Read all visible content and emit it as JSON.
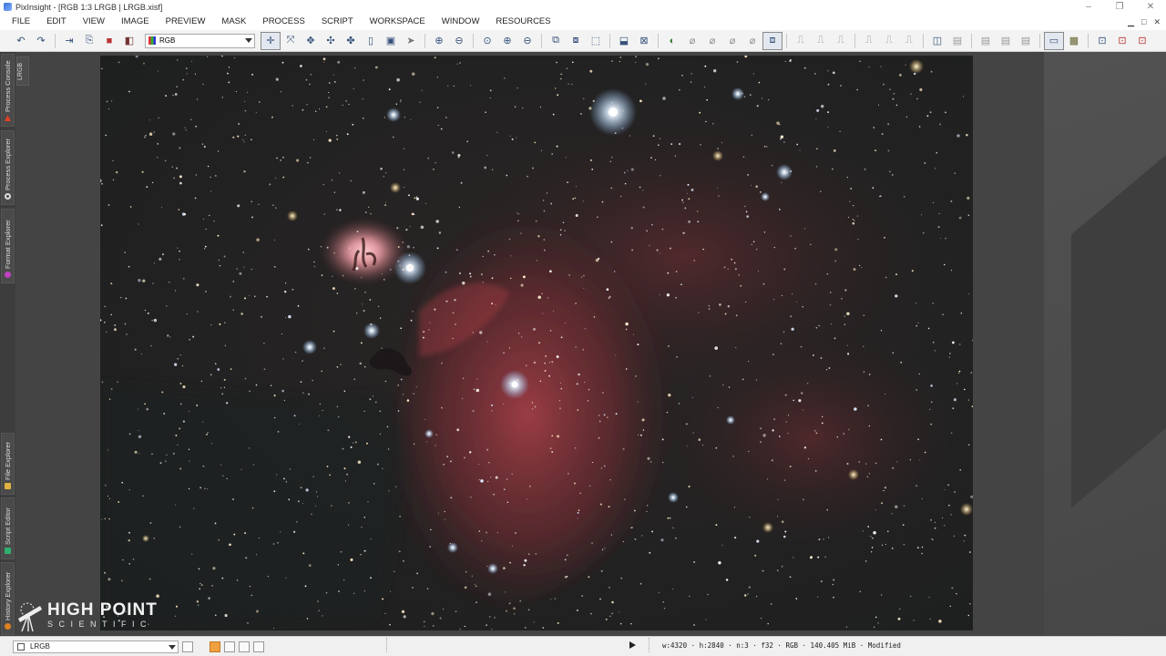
{
  "window": {
    "title": "PixInsight - [RGB 1:3 LRGB | LRGB.xisf]",
    "controls": [
      "–",
      "❐",
      "✕"
    ]
  },
  "menubar": {
    "items": [
      "FILE",
      "EDIT",
      "VIEW",
      "IMAGE",
      "PREVIEW",
      "MASK",
      "PROCESS",
      "SCRIPT",
      "WORKSPACE",
      "WINDOW",
      "RESOURCES"
    ]
  },
  "toolbar": {
    "channel_select": "RGB"
  },
  "sidebar": {
    "tabs": [
      "Process Console",
      "Process Explorer",
      "Format Explorer",
      "File Explorer",
      "Script Editor",
      "History Explorer"
    ],
    "view_tab": "LRGB"
  },
  "statusbar": {
    "view_select": "LRGB",
    "info": "w:4320 · h:2840 · n:3 · f32 · RGB · 140.405 MiB · Modified"
  },
  "watermark": {
    "line1": "HIGH POINT",
    "line2": "SCIENTIFIC"
  },
  "colors": {
    "accent": "#35527a",
    "nebula": "#c4454f",
    "flame": "#f0a0a8",
    "star_blue": "#cfe8ff"
  }
}
